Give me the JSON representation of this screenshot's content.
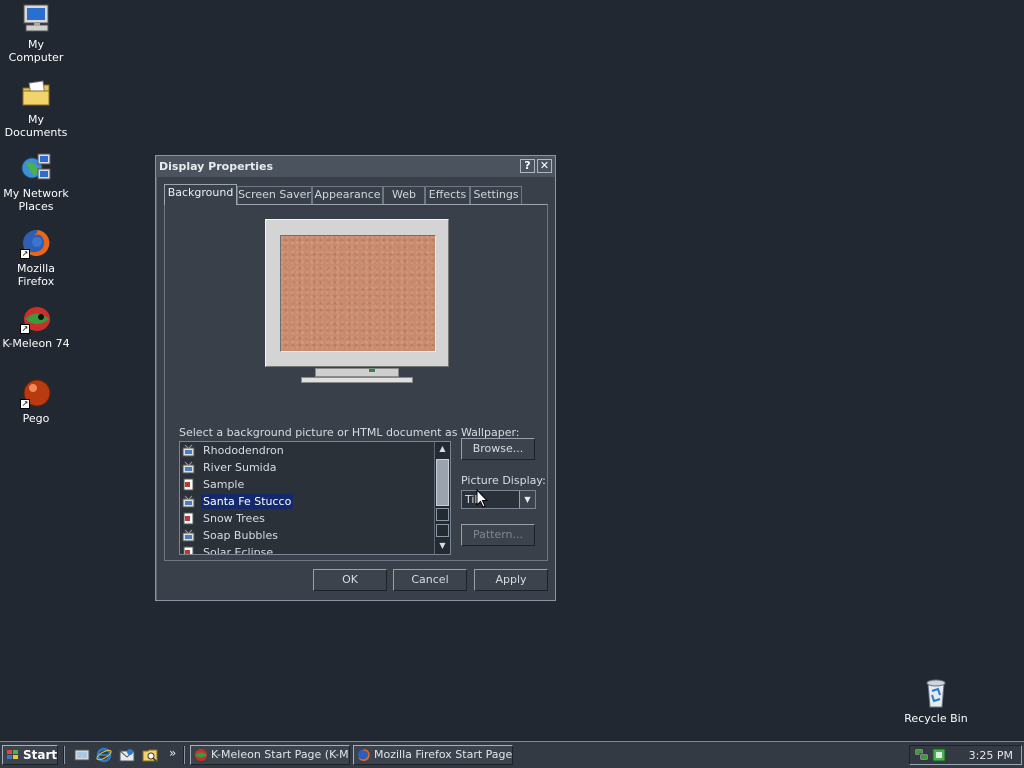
{
  "desktop": {
    "icons": [
      {
        "label": "My Computer"
      },
      {
        "label": "My Documents"
      },
      {
        "label": "My Network Places"
      },
      {
        "label": "Mozilla Firefox"
      },
      {
        "label": "K-Meleon 74"
      },
      {
        "label": "Pego"
      },
      {
        "label": "Recycle Bin"
      }
    ]
  },
  "dialog": {
    "title": "Display Properties",
    "help_label": "?",
    "close_label": "✕",
    "tabs": [
      {
        "label": "Background"
      },
      {
        "label": "Screen Saver"
      },
      {
        "label": "Appearance"
      },
      {
        "label": "Web"
      },
      {
        "label": "Effects"
      },
      {
        "label": "Settings"
      }
    ],
    "active_tab": "Background",
    "wallpaper_prompt": "Select a background picture or HTML document as Wallpaper:",
    "wallpapers": [
      {
        "label": "Rhododendron",
        "icon": "wallpaper-image-icon"
      },
      {
        "label": "River Sumida",
        "icon": "wallpaper-image-icon"
      },
      {
        "label": "Sample",
        "icon": "html-document-icon"
      },
      {
        "label": "Santa Fe Stucco",
        "icon": "wallpaper-image-icon",
        "selected": true
      },
      {
        "label": "Snow Trees",
        "icon": "html-document-icon"
      },
      {
        "label": "Soap Bubbles",
        "icon": "wallpaper-image-icon"
      },
      {
        "label": "Solar Eclipse",
        "icon": "html-document-icon"
      }
    ],
    "browse_label": "Browse...",
    "picture_display_label": "Picture Display:",
    "picture_display_value": "Tile",
    "pattern_label": "Pattern...",
    "ok_label": "OK",
    "cancel_label": "Cancel",
    "apply_label": "Apply",
    "preview_color": "#c98a6e"
  },
  "taskbar": {
    "start_label": "Start",
    "quick_launch": [
      "show-desktop-icon",
      "internet-explorer-icon",
      "outlook-express-icon",
      "folder-search-icon"
    ],
    "chevron": "»",
    "tasks": [
      {
        "label": "K-Meleon Start Page (K-M...",
        "icon": "k-meleon-icon"
      },
      {
        "label": "Mozilla Firefox Start Page...",
        "icon": "firefox-icon"
      }
    ],
    "clock": "3:25 PM"
  }
}
